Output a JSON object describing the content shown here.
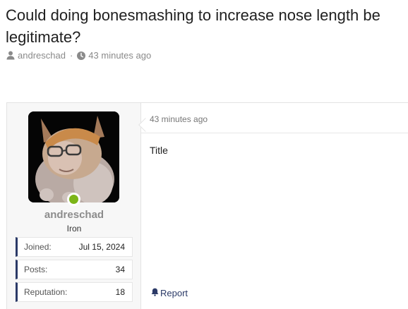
{
  "thread": {
    "title": "Could doing bonesmashing to increase nose length be legitimate?",
    "author": "andreschad",
    "separator": "·",
    "time": "43 minutes ago"
  },
  "user": {
    "name": "andreschad",
    "rank": "Iron",
    "online_color": "#7cb518",
    "stats": [
      {
        "label": "Joined:",
        "value": "Jul 15, 2024"
      },
      {
        "label": "Posts:",
        "value": "34"
      },
      {
        "label": "Reputation:",
        "value": "18"
      }
    ]
  },
  "post": {
    "date": "43 minutes ago",
    "body": "Title",
    "report_label": "Report"
  },
  "icons": {
    "author": "user-icon",
    "time": "clock-icon",
    "report": "bell-icon"
  },
  "colors": {
    "accent": "#2b3a67",
    "muted": "#8a8a8a"
  }
}
